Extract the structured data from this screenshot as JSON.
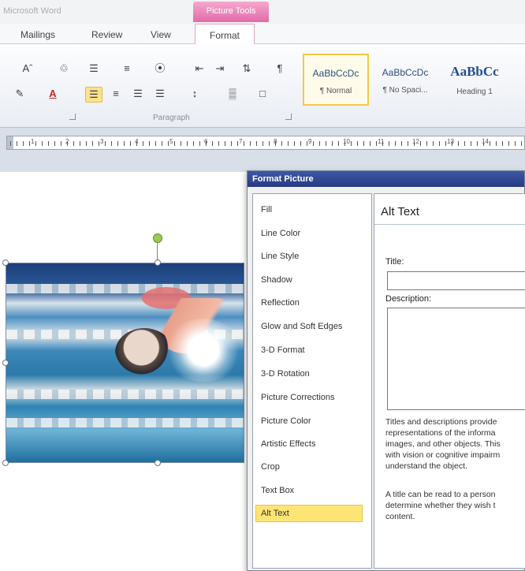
{
  "app": {
    "title": "Microsoft Word",
    "context_tab": "Picture Tools"
  },
  "tabs": {
    "mailings": "Mailings",
    "review": "Review",
    "view": "View",
    "format": "Format"
  },
  "ribbon": {
    "paragraph_label": "Paragraph",
    "icons": {
      "grow_font": "Aˆ",
      "change_case": "Aaˇ",
      "clear_format": "♲",
      "highlight": "✎",
      "font_color": "A",
      "bullets": "☰",
      "numbering": "≡",
      "multilevel": "⦿",
      "decrease_indent": "⇤",
      "increase_indent": "⇥",
      "sort": "⇅",
      "pilcrow": "¶",
      "align_left": "☰",
      "center": "≡",
      "align_right": "☰",
      "justify": "☰",
      "line_spacing": "↕",
      "shading": "▒",
      "borders": "□"
    },
    "styles": [
      {
        "sample": "AaBbCcDc",
        "name": "¶ Normal"
      },
      {
        "sample": "AaBbCcDc",
        "name": "¶ No Spaci..."
      },
      {
        "sample": "AaBbCc",
        "name": "Heading 1"
      }
    ]
  },
  "ruler": {
    "numbers": [
      "1",
      "2",
      "3",
      "4",
      "5",
      "6",
      "7",
      "8",
      "9",
      "10",
      "11",
      "12",
      "13",
      "14"
    ]
  },
  "dialog": {
    "title": "Format Picture",
    "categories": [
      {
        "label": "Fill"
      },
      {
        "label": "Line Color"
      },
      {
        "label": "Line Style"
      },
      {
        "label": "Shadow"
      },
      {
        "label": "Reflection"
      },
      {
        "label": "Glow and Soft Edges"
      },
      {
        "label": "3-D Format"
      },
      {
        "label": "3-D Rotation"
      },
      {
        "label": "Picture Corrections"
      },
      {
        "label": "Picture Color"
      },
      {
        "label": "Artistic Effects"
      },
      {
        "label": "Crop"
      },
      {
        "label": "Text Box"
      },
      {
        "label": "Alt Text"
      }
    ],
    "pane_title": "Alt Text",
    "title_label": "Title:",
    "title_value": "",
    "description_label": "Description:",
    "description_value": "",
    "help_1": "Titles and descriptions provide\nrepresentations of the informa\nimages, and other objects. This\nwith vision or cognitive impairm\nunderstand the object.",
    "help_2": "A title can be read to a person\ndetermine whether they wish t\ncontent."
  }
}
